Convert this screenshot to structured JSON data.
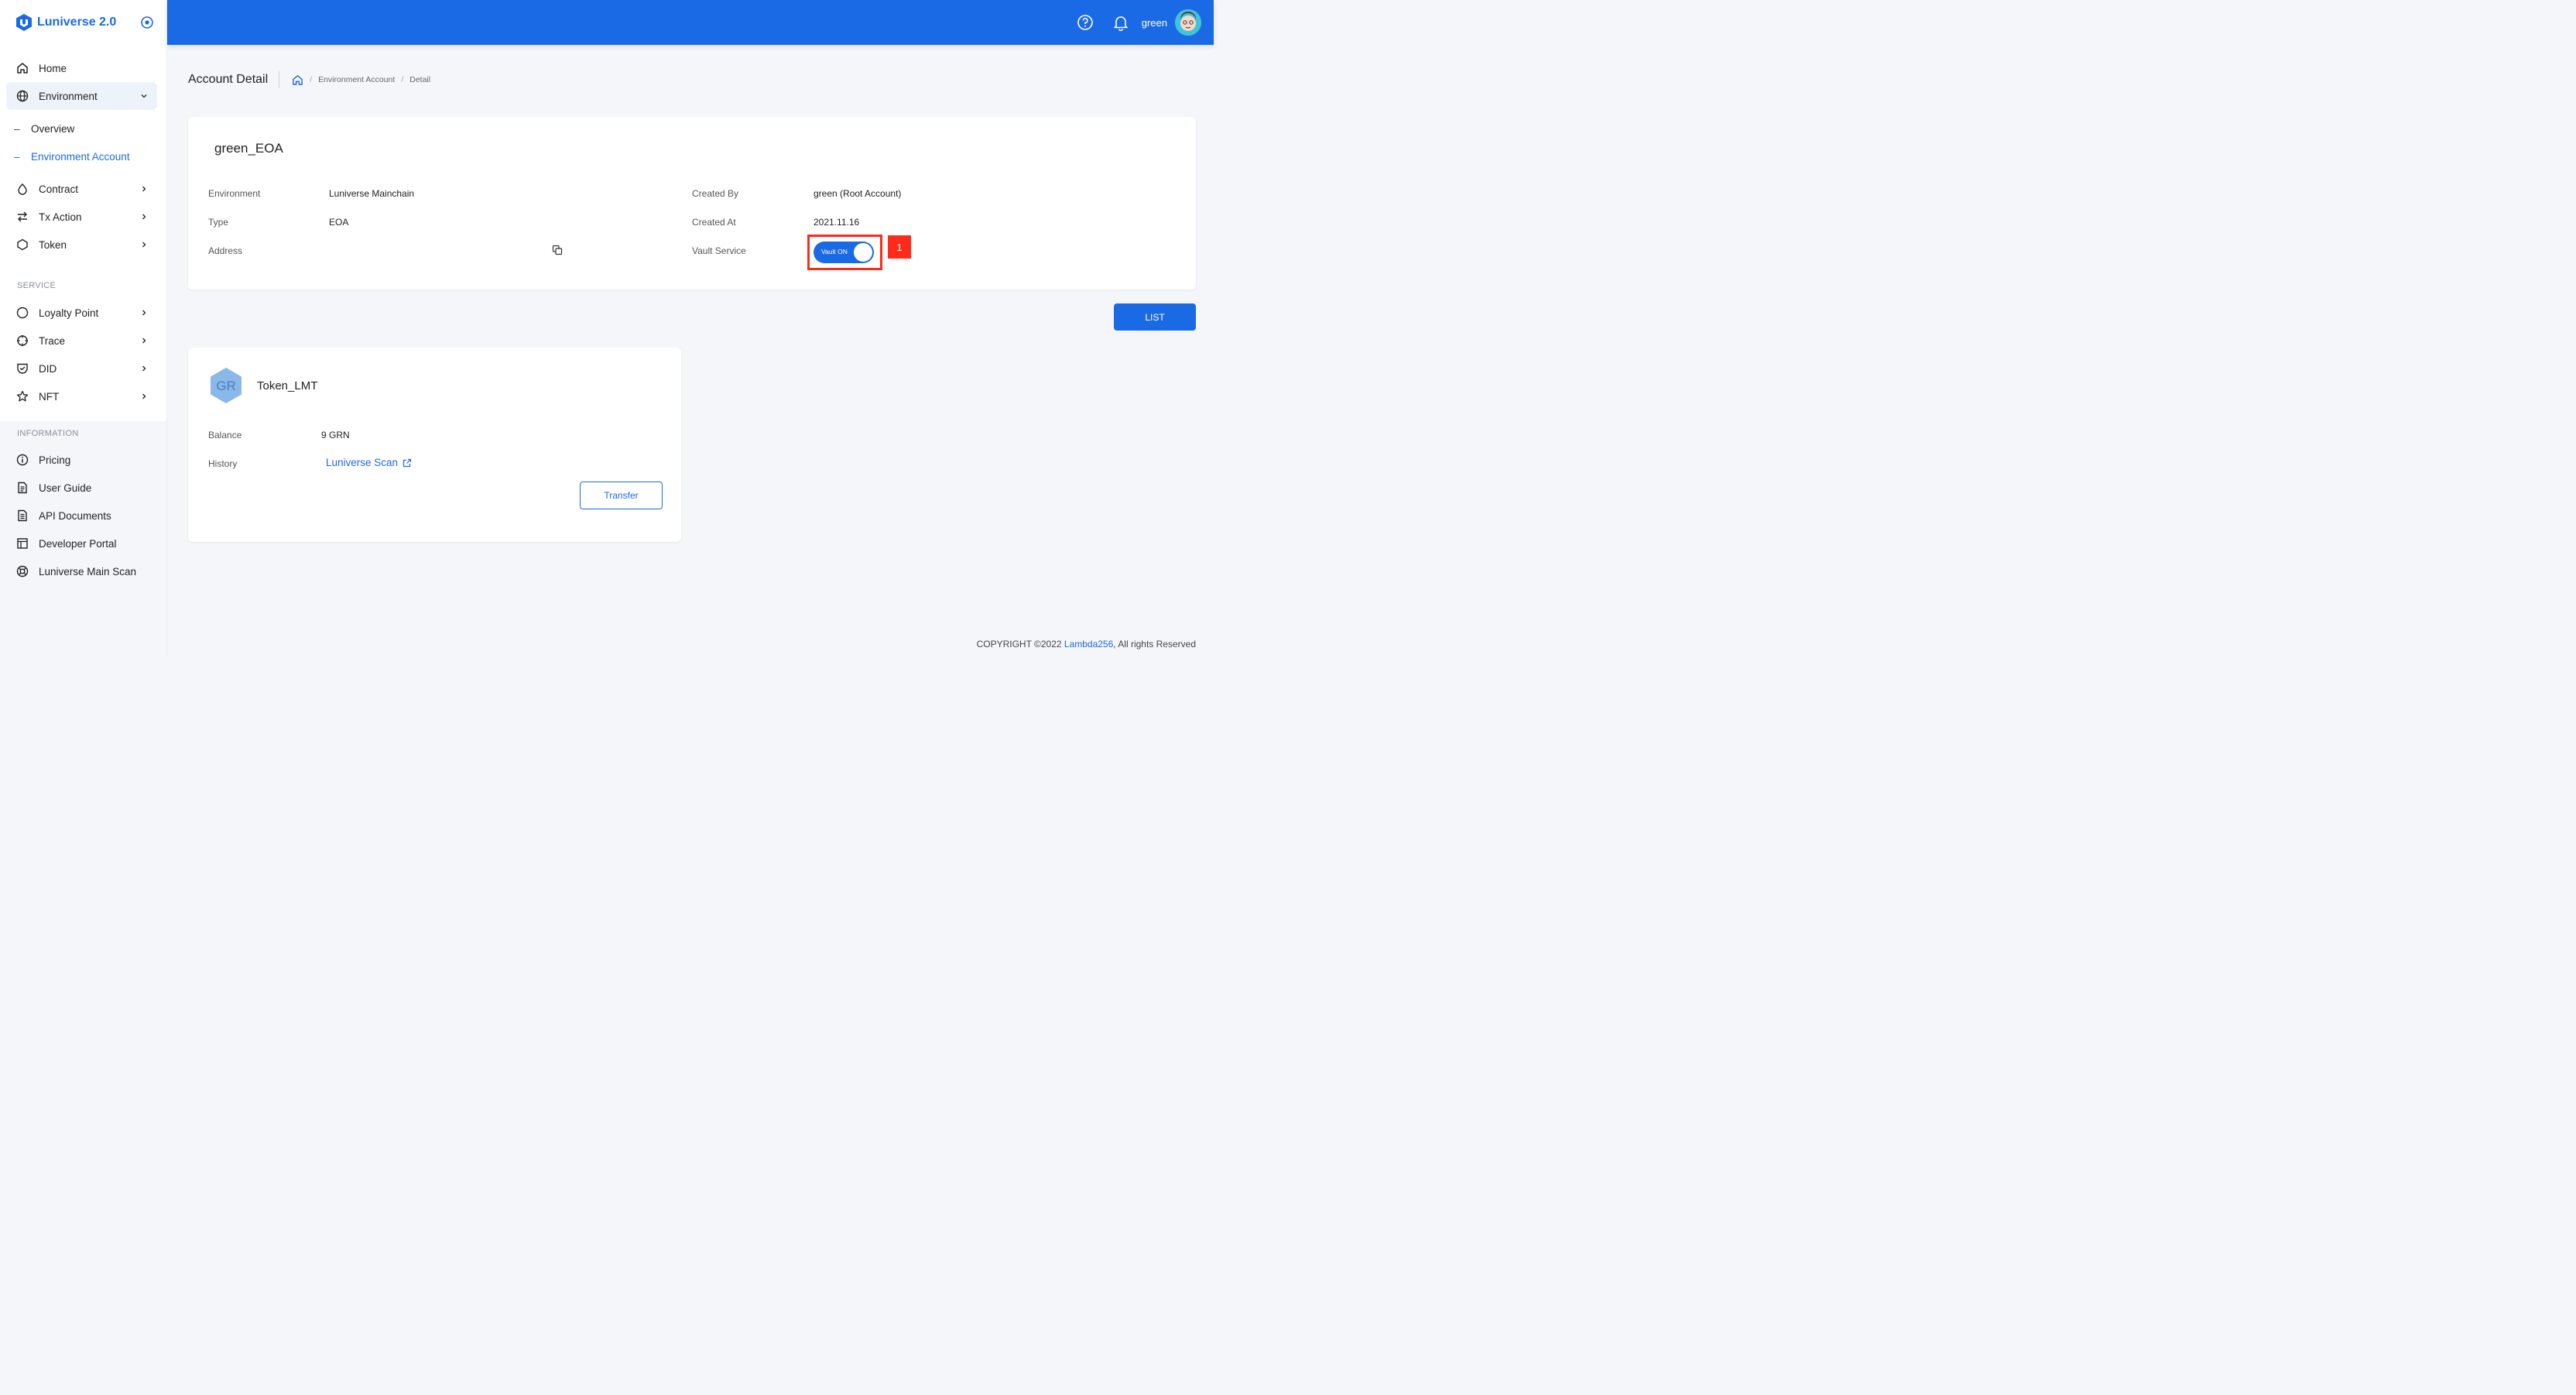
{
  "app": {
    "logo_text": "Luniverse 2.0"
  },
  "header": {
    "username": "green"
  },
  "sidebar": {
    "items": [
      {
        "label": "Home",
        "icon": "home-icon"
      },
      {
        "label": "Environment",
        "icon": "globe-icon"
      },
      {
        "label": "Contract",
        "icon": "droplet-icon"
      },
      {
        "label": "Tx Action",
        "icon": "arrows-icon"
      },
      {
        "label": "Token",
        "icon": "hexagon-icon"
      }
    ],
    "env_sub": [
      "Overview",
      "Environment Account"
    ],
    "service_label": "SERVICE",
    "service_items": [
      {
        "label": "Loyalty Point",
        "icon": "circle-icon"
      },
      {
        "label": "Trace",
        "icon": "crosshair-icon"
      },
      {
        "label": "DID",
        "icon": "shield-check-icon"
      },
      {
        "label": "NFT",
        "icon": "star-icon"
      }
    ],
    "info_label": "INFORMATION",
    "info_items": [
      {
        "label": "Pricing",
        "icon": "info-icon"
      },
      {
        "label": "User Guide",
        "icon": "document-icon"
      },
      {
        "label": "API Documents",
        "icon": "file-text-icon"
      },
      {
        "label": "Developer Portal",
        "icon": "layout-icon"
      },
      {
        "label": "Luniverse Main Scan",
        "icon": "lifebuoy-icon"
      }
    ]
  },
  "page": {
    "title": "Account Detail",
    "breadcrumb": [
      "Environment Account",
      "Detail"
    ]
  },
  "account": {
    "name": "green_EOA",
    "environment_label": "Environment",
    "environment_value": "Luniverse Mainchain",
    "type_label": "Type",
    "type_value": "EOA",
    "address_label": "Address",
    "created_by_label": "Created By",
    "created_by_value": "green (Root Account)",
    "created_at_label": "Created At",
    "created_at_value": "2021.11.16",
    "vault_label": "Vault Service",
    "vault_toggle_text": "Vault ON",
    "annotation_number": "1"
  },
  "list_button": "LIST",
  "token": {
    "avatar_text": "GR",
    "name": "Token_LMT",
    "balance_label": "Balance",
    "balance_value": "9 GRN",
    "history_label": "History",
    "history_link": "Luniverse Scan",
    "transfer_button": "Transfer"
  },
  "footer": {
    "prefix": "COPYRIGHT ©2022 ",
    "brand": "Lambda256",
    "suffix": ", All rights Reserved"
  },
  "colors": {
    "primary": "#1b6ae5",
    "highlight": "#ff2a1a",
    "token_avatar": "#8ab8e8"
  }
}
